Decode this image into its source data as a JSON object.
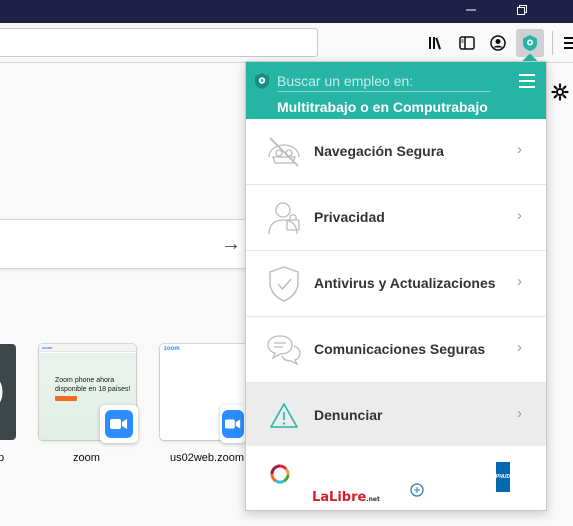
{
  "window": {
    "controls": {
      "minimize_icon": "minimize-icon",
      "restore_icon": "restore-icon"
    }
  },
  "toolbar": {
    "icons": [
      "library-icon",
      "sidebar-icon",
      "account-icon",
      "extension-icon",
      "hamburger-menu-icon"
    ]
  },
  "new_tab": {
    "settings_icon": "gear-icon",
    "search_arrow": "→",
    "tiles": [
      {
        "label": "p"
      },
      {
        "label": "zoom",
        "preview_text": "Zoom phone ahora disponible en 18 países!",
        "preview_logo": "zoom"
      },
      {
        "label": "us02web.zoom",
        "preview_logo": "zoom"
      }
    ]
  },
  "popup": {
    "header": {
      "search_placeholder": "Buscar un empleo en:",
      "subtitle": "Multitrabajo o en Computrabajo"
    },
    "items": [
      {
        "label": "Navegación Segura",
        "icon": "safe-browsing-icon"
      },
      {
        "label": "Privacidad",
        "icon": "privacy-icon"
      },
      {
        "label": "Antivirus y Actualizaciones",
        "icon": "shield-check-icon"
      },
      {
        "label": "Comunicaciones Seguras",
        "icon": "chat-bubbles-icon"
      },
      {
        "label": "Denunciar",
        "icon": "warning-icon"
      }
    ],
    "chevron": "›",
    "footer": {
      "logo_lalibre": "LaLibre",
      "logo_lalibre_suffix": ".net",
      "logo_undp": "PNUD"
    }
  },
  "colors": {
    "titlebar": "#1f2246",
    "popup_header": "#26b5a5",
    "active_item": "#ececec",
    "warning_icon": "#26b5a5"
  }
}
